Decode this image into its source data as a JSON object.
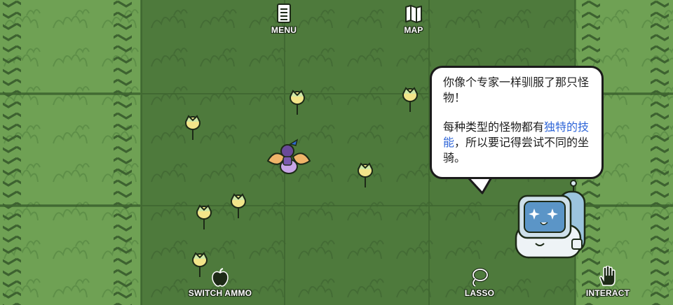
{
  "hud": {
    "menu_label": "MENU",
    "map_label": "MAP",
    "switch_ammo_label": "SWITCH AMMO",
    "lasso_label": "LASSO",
    "interact_label": "INTERACT"
  },
  "dialog": {
    "line1": "你像个专家一样驯服了那只怪物！",
    "line2_before": "每种类型的怪物都有",
    "line2_highlight": "独特的技能",
    "line2_after": "，所以要记得尝试不同的坐骑。"
  },
  "colors": {
    "grass_dark": "#4e7a3c",
    "grass_light": "#6fa154",
    "highlight_text": "#2f66d8"
  },
  "icons": {
    "menu": "menu-icon",
    "map": "map-icon",
    "switch_ammo": "apple-icon",
    "lasso": "lasso-icon",
    "interact": "hand-icon"
  }
}
